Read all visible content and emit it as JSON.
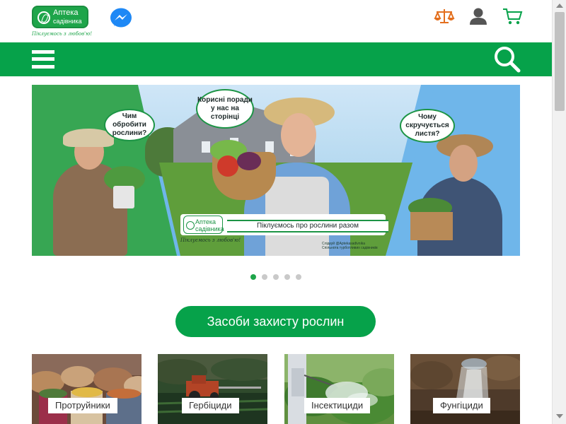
{
  "header": {
    "logo": {
      "name": "Аптека",
      "sub": "садівника",
      "slogan": "Піклуємось з любов'ю!"
    },
    "icons": [
      "messenger-icon",
      "compare-scales-icon",
      "user-icon",
      "cart-icon"
    ],
    "colors": {
      "brand_green": "#06a24a",
      "compare_orange": "#e36f1e",
      "icon_gray": "#555555",
      "messenger_blue": "#1e88f5"
    }
  },
  "navbar": {
    "icons": [
      "menu-icon",
      "search-icon"
    ]
  },
  "banner": {
    "bubble_left": "Чим обробити рослини?",
    "bubble_mid": "Корисні поради у нас на сторінці",
    "bubble_right": "Чому скручується листя?",
    "plate_logo_name": "Аптека",
    "plate_logo_sub": "садівника",
    "plate_text": "Піклуємось про рослини разом",
    "plate_slogan": "Піклуємось з любов'ю!",
    "social_line1": "Слідкуй @Aptekasadivnika",
    "social_line2": "Спільнота турботливих садівників",
    "slides_count": 5,
    "active_slide": 1
  },
  "cta_label": "Засоби захисту рослин",
  "categories": [
    {
      "label": "Протруйники"
    },
    {
      "label": "Гербіциди"
    },
    {
      "label": "Інсектициди"
    },
    {
      "label": "Фунгіциди"
    }
  ]
}
